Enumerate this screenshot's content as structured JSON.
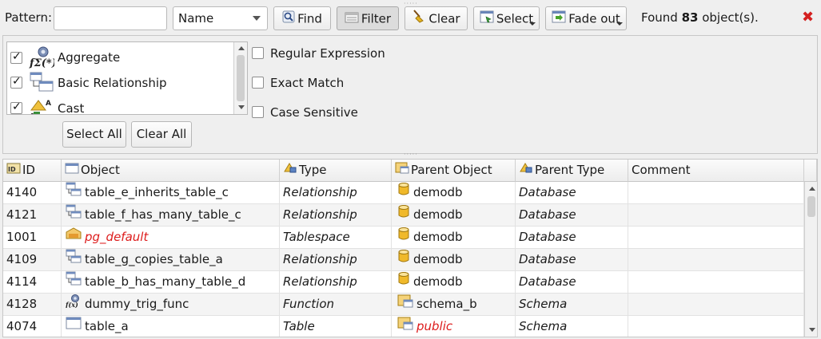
{
  "toolbar": {
    "pattern_label": "Pattern:",
    "pattern_value": "",
    "search_field": "Name",
    "find_label": "Find",
    "filter_label": "Filter",
    "clear_label": "Clear",
    "select_label": "Select",
    "fade_label": "Fade out",
    "found_prefix": "Found ",
    "found_count": "83",
    "found_suffix": " object(s).",
    "close_glyph": "✖"
  },
  "filter": {
    "types": [
      {
        "label": "Aggregate",
        "checked": true,
        "icon": "aggregate-icon"
      },
      {
        "label": "Basic Relationship",
        "checked": true,
        "icon": "basic-relationship-icon"
      },
      {
        "label": "Cast",
        "checked": true,
        "icon": "cast-icon"
      }
    ],
    "options": [
      {
        "label": "Regular Expression",
        "checked": false
      },
      {
        "label": "Exact Match",
        "checked": false
      },
      {
        "label": "Case Sensitive",
        "checked": false
      }
    ],
    "select_all_label": "Select All",
    "clear_all_label": "Clear All"
  },
  "table": {
    "headers": [
      "ID",
      "Object",
      "Type",
      "Parent Object",
      "Parent Type",
      "Comment"
    ],
    "rows": [
      {
        "id": "4140",
        "object": "table_e_inherits_table_c",
        "type": "Relationship",
        "parent": "demodb",
        "parent_type": "Database",
        "comment": "",
        "object_icon": "relationship-icon",
        "parent_icon": "database-icon"
      },
      {
        "id": "4121",
        "object": "table_f_has_many_table_c",
        "type": "Relationship",
        "parent": "demodb",
        "parent_type": "Database",
        "comment": "",
        "object_icon": "relationship-icon",
        "parent_icon": "database-icon"
      },
      {
        "id": "1001",
        "object": "pg_default",
        "type": "Tablespace",
        "parent": "demodb",
        "parent_type": "Database",
        "comment": "",
        "object_icon": "tablespace-icon",
        "parent_icon": "database-icon"
      },
      {
        "id": "4109",
        "object": "table_g_copies_table_a",
        "type": "Relationship",
        "parent": "demodb",
        "parent_type": "Database",
        "comment": "",
        "object_icon": "relationship-icon",
        "parent_icon": "database-icon"
      },
      {
        "id": "4114",
        "object": "table_b_has_many_table_d",
        "type": "Relationship",
        "parent": "demodb",
        "parent_type": "Database",
        "comment": "",
        "object_icon": "relationship-icon",
        "parent_icon": "database-icon"
      },
      {
        "id": "4128",
        "object": "dummy_trig_func",
        "type": "Function",
        "parent": "schema_b",
        "parent_type": "Schema",
        "comment": "",
        "object_icon": "function-icon",
        "parent_icon": "schema-icon"
      },
      {
        "id": "4074",
        "object": "table_a",
        "type": "Table",
        "parent": "public",
        "parent_type": "Schema",
        "comment": "",
        "object_icon": "table-icon",
        "parent_icon": "schema-icon"
      }
    ]
  },
  "colors": {
    "highlight_red": "#dd1c1c",
    "close_red": "#d42020"
  }
}
